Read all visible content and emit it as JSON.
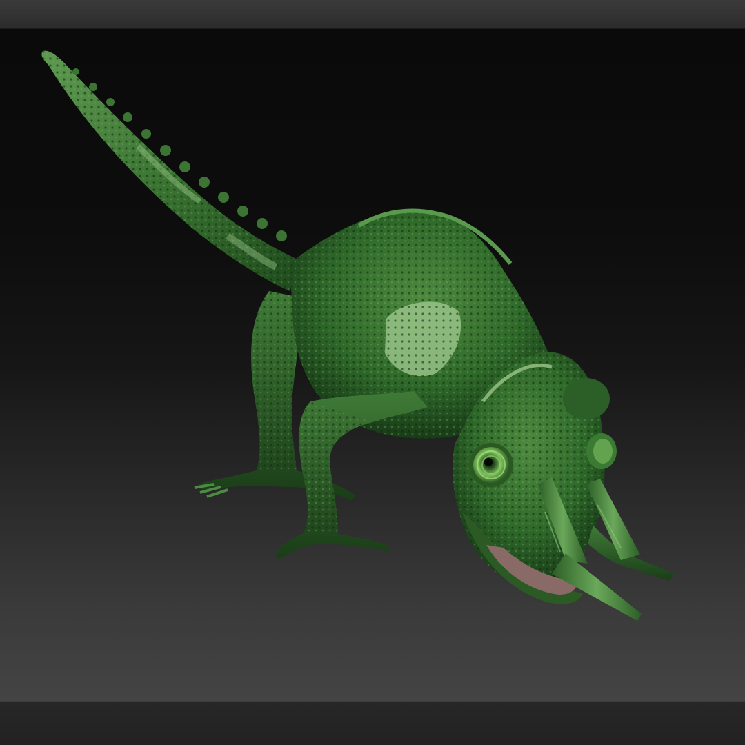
{
  "app": {
    "top_bar_color": "#333333",
    "viewport_bg_top": "#0a0a0a",
    "viewport_bg_bottom": "#444444",
    "bottom_bar_color": "#242424"
  },
  "model": {
    "subject": "chameleon",
    "skin_color": "#2f6a2a",
    "highlight_color": "#8fbf7a",
    "shadow_color": "#0f2a0e"
  }
}
